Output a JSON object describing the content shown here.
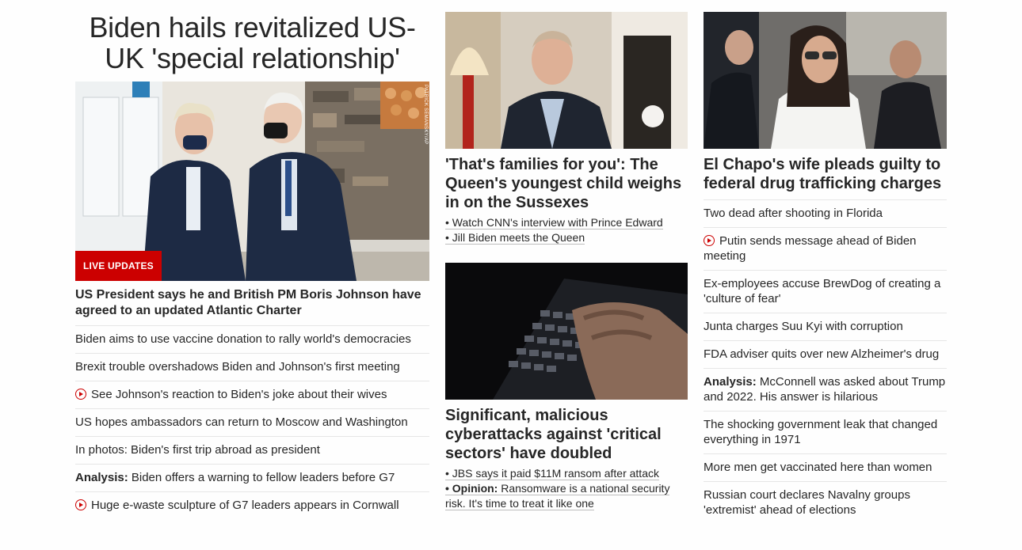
{
  "lead": {
    "headline": "Biden hails revitalized US-UK 'special relationship'",
    "badge": "LIVE UPDATES",
    "photo_credit": "PATRICK SEMANSKY/AP",
    "title": "US President says he and British PM Boris Johnson have agreed to an updated Atlantic Charter",
    "stories": [
      {
        "prefix": "",
        "text": "Biden aims to use vaccine donation to rally world's democracies",
        "video": false
      },
      {
        "prefix": "",
        "text": "Brexit trouble overshadows Biden and Johnson's first meeting",
        "video": false
      },
      {
        "prefix": "",
        "text": "See Johnson's reaction to Biden's joke about their wives",
        "video": true
      },
      {
        "prefix": "",
        "text": "US hopes ambassadors can return to Moscow and Washington",
        "video": false
      },
      {
        "prefix": "",
        "text": "In photos: Biden's first trip abroad as president",
        "video": false
      },
      {
        "prefix": "Analysis:",
        "text": " Biden offers a warning to fellow leaders before G7",
        "video": false
      },
      {
        "prefix": "",
        "text": "Huge e-waste sculpture of G7 leaders appears in Cornwall",
        "video": true
      }
    ]
  },
  "middle": {
    "story1": {
      "title": "'That's families for you': The Queen's youngest child weighs in on the Sussexes",
      "links": [
        "• Watch CNN's interview with Prince Edward",
        "• Jill Biden meets the Queen"
      ]
    },
    "story2": {
      "title": "Significant, malicious cyberattacks against 'critical sectors' have doubled",
      "link1": "• JBS says it paid $11M ransom after attack",
      "link2_prefix": "• Opinion:",
      "link2_text": " Ransomware is a national security risk. It's time to treat it like one"
    }
  },
  "right": {
    "title": "El Chapo's wife pleads guilty to federal drug trafficking charges",
    "stories": [
      {
        "prefix": "",
        "text": "Two dead after shooting in Florida",
        "video": false
      },
      {
        "prefix": "",
        "text": "Putin sends message ahead of Biden meeting",
        "video": true
      },
      {
        "prefix": "",
        "text": "Ex-employees accuse BrewDog of creating a 'culture of fear'",
        "video": false
      },
      {
        "prefix": "",
        "text": "Junta charges Suu Kyi with corruption",
        "video": false
      },
      {
        "prefix": "",
        "text": "FDA adviser quits over new Alzheimer's drug",
        "video": false
      },
      {
        "prefix": "Analysis:",
        "text": " McConnell was asked about Trump and 2022. His answer is hilarious",
        "video": false
      },
      {
        "prefix": "",
        "text": "The shocking government leak that changed everything in 1971",
        "video": false
      },
      {
        "prefix": "",
        "text": "More men get vaccinated here than women",
        "video": false
      },
      {
        "prefix": "",
        "text": "Russian court declares Navalny groups 'extremist' ahead of elections",
        "video": false
      }
    ]
  },
  "colors": {
    "accent": "#cc0000",
    "divider": "#e6e6e6",
    "text": "#262626"
  }
}
